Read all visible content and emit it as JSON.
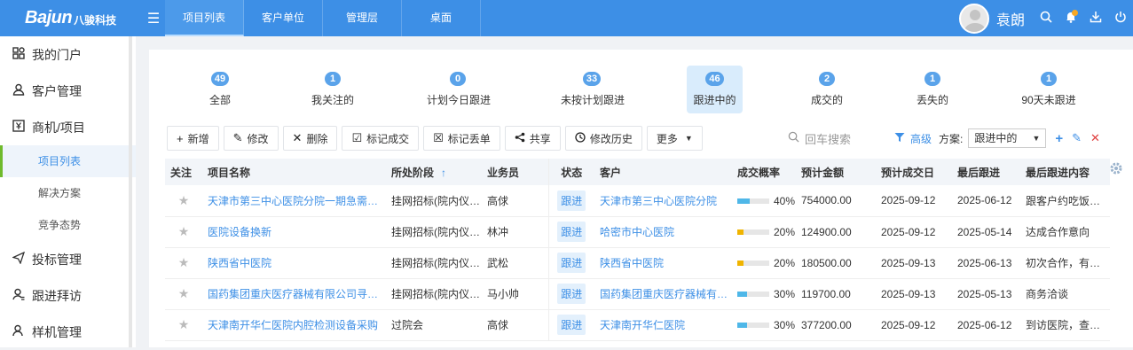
{
  "header": {
    "logo_brand": "Bajun",
    "logo_cn": "八骏科技",
    "tabs": [
      {
        "label": "项目列表",
        "active": true
      },
      {
        "label": "客户单位",
        "active": false
      },
      {
        "label": "管理层",
        "active": false
      },
      {
        "label": "桌面",
        "active": false
      }
    ],
    "username": "袁朗",
    "accent": "#3d8fe6"
  },
  "sidebar": {
    "items": [
      {
        "label": "我的门户",
        "icon": "grid-icon"
      },
      {
        "label": "客户管理",
        "icon": "user-icon"
      },
      {
        "label": "商机/项目",
        "icon": "yen-icon"
      }
    ],
    "subitems": [
      {
        "label": "项目列表",
        "active": true
      },
      {
        "label": "解决方案",
        "active": false
      },
      {
        "label": "竞争态势",
        "active": false
      }
    ],
    "items2": [
      {
        "label": "投标管理",
        "icon": "send-icon"
      },
      {
        "label": "跟进拜访",
        "icon": "visit-icon"
      },
      {
        "label": "样机管理",
        "icon": "sample-icon"
      }
    ]
  },
  "stats": [
    {
      "count": "49",
      "label": "全部"
    },
    {
      "count": "1",
      "label": "我关注的"
    },
    {
      "count": "0",
      "label": "计划今日跟进"
    },
    {
      "count": "33",
      "label": "未按计划跟进"
    },
    {
      "count": "46",
      "label": "跟进中的",
      "active": true
    },
    {
      "count": "2",
      "label": "成交的"
    },
    {
      "count": "1",
      "label": "丢失的"
    },
    {
      "count": "1",
      "label": "90天未跟进"
    }
  ],
  "toolbar": {
    "add": "新增",
    "edit": "修改",
    "delete": "删除",
    "mark_won": "标记成交",
    "mark_lost": "标记丢单",
    "share": "共享",
    "history": "修改历史",
    "more": "更多"
  },
  "search": {
    "placeholder": "回车搜索",
    "advanced": "高级",
    "plan_label": "方案:",
    "plan_value": "跟进中的"
  },
  "table": {
    "columns": [
      "关注",
      "项目名称",
      "所处阶段",
      "业务员",
      "状态",
      "客户",
      "成交概率",
      "预计金额",
      "预计成交日",
      "最后跟进",
      "最后跟进内容"
    ],
    "rows": [
      {
        "name": "天津市第三中心医院分院一期急需品…",
        "stage": "挂网招标(院内仪标)",
        "sales": "高俅",
        "status": "跟进",
        "customer": "天津市第三中心医院分院",
        "prob": 40,
        "prob_label": "40%",
        "amount": "754000.00",
        "expected": "2025-09-12",
        "last": "2025-06-12",
        "content": "跟客户约吃饭，推"
      },
      {
        "name": "医院设备换新",
        "stage": "挂网招标(院内仪标)",
        "sales": "林冲",
        "status": "跟进",
        "customer": "哈密市中心医院",
        "prob": 20,
        "prob_label": "20%",
        "amount": "124900.00",
        "expected": "2025-09-12",
        "last": "2025-05-14",
        "content": "达成合作意向"
      },
      {
        "name": "陕西省中医院",
        "stage": "挂网招标(院内仪标)",
        "sales": "武松",
        "status": "跟进",
        "customer": "陕西省中医院",
        "prob": 20,
        "prob_label": "20%",
        "amount": "180500.00",
        "expected": "2025-09-13",
        "last": "2025-06-13",
        "content": "初次合作，有意向"
      },
      {
        "name": "国药集团重庆医疗器械有限公司寻找…",
        "stage": "挂网招标(院内仪标)",
        "sales": "马小帅",
        "status": "跟进",
        "customer": "国药集团重庆医疗器械有限…",
        "prob": 30,
        "prob_label": "30%",
        "amount": "119700.00",
        "expected": "2025-09-13",
        "last": "2025-05-13",
        "content": "商务洽谈"
      },
      {
        "name": "天津南开华仁医院内腔检测设备采购",
        "stage": "过院会",
        "sales": "高俅",
        "status": "跟进",
        "customer": "天津南开华仁医院",
        "prob": 30,
        "prob_label": "30%",
        "amount": "377200.00",
        "expected": "2025-09-12",
        "last": "2025-06-12",
        "content": "到访医院，查看设"
      }
    ],
    "prob_colors": {
      "20": "#f0b400",
      "30": "#4fb7e8",
      "40": "#4fb7e8"
    }
  }
}
